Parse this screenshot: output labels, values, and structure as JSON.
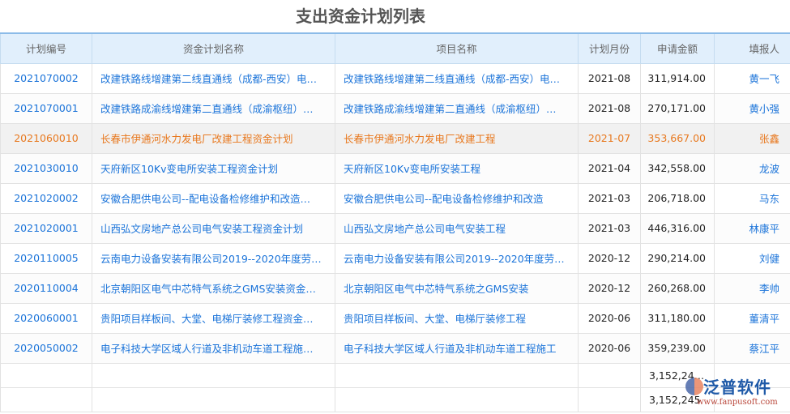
{
  "title": "支出资金计划列表",
  "columns": [
    "计划编号",
    "资金计划名称",
    "项目名称",
    "计划月份",
    "申请金额",
    "填报人"
  ],
  "rows": [
    {
      "id": "2021070002",
      "plan": "改建铁路线增建第二线直通线（成都-西安）电…",
      "project": "改建铁路线增建第二线直通线（成都-西安）电…",
      "month": "2021-08",
      "amount": "311,914.00",
      "person": "黄一飞"
    },
    {
      "id": "2021070001",
      "plan": "改建铁路成渝线增建第二直通线（成渝枢纽）…",
      "project": "改建铁路成渝线增建第二直通线（成渝枢纽）…",
      "month": "2021-08",
      "amount": "270,171.00",
      "person": "黄小强"
    },
    {
      "id": "2021060010",
      "plan": "长春市伊通河水力发电厂改建工程资金计划",
      "project": "长春市伊通河水力发电厂改建工程",
      "month": "2021-07",
      "amount": "353,667.00",
      "person": "张鑫"
    },
    {
      "id": "2021030010",
      "plan": "天府新区10Kv变电所安装工程资金计划",
      "project": "天府新区10Kv变电所安装工程",
      "month": "2021-04",
      "amount": "342,558.00",
      "person": "龙波"
    },
    {
      "id": "2021020002",
      "plan": "安徽合肥供电公司--配电设备检修维护和改造…",
      "project": "安徽合肥供电公司--配电设备检修维护和改造",
      "month": "2021-03",
      "amount": "206,718.00",
      "person": "马东"
    },
    {
      "id": "2021020001",
      "plan": "山西弘文房地产总公司电气安装工程资金计划",
      "project": "山西弘文房地产总公司电气安装工程",
      "month": "2021-03",
      "amount": "446,316.00",
      "person": "林康平"
    },
    {
      "id": "2020110005",
      "plan": "云南电力设备安装有限公司2019--2020年度劳…",
      "project": "云南电力设备安装有限公司2019--2020年度劳…",
      "month": "2020-12",
      "amount": "290,214.00",
      "person": "刘健"
    },
    {
      "id": "2020110004",
      "plan": "北京朝阳区电气中芯特气系统之GMS安装资金…",
      "project": "北京朝阳区电气中芯特气系统之GMS安装",
      "month": "2020-12",
      "amount": "260,268.00",
      "person": "李帅"
    },
    {
      "id": "2020060001",
      "plan": "贵阳项目样板间、大堂、电梯厅装修工程资金…",
      "project": "贵阳项目样板间、大堂、电梯厅装修工程",
      "month": "2020-06",
      "amount": "311,180.00",
      "person": "董清平"
    },
    {
      "id": "2020050002",
      "plan": "电子科技大学区域人行道及非机动车道工程施…",
      "project": "电子科技大学区域人行道及非机动车道工程施工",
      "month": "2020-06",
      "amount": "359,239.00",
      "person": "蔡江平"
    }
  ],
  "totals": [
    "3,152,245…",
    "3,152,245"
  ],
  "logo": {
    "name": "泛普软件",
    "url": "www.fanpusoft.com"
  }
}
